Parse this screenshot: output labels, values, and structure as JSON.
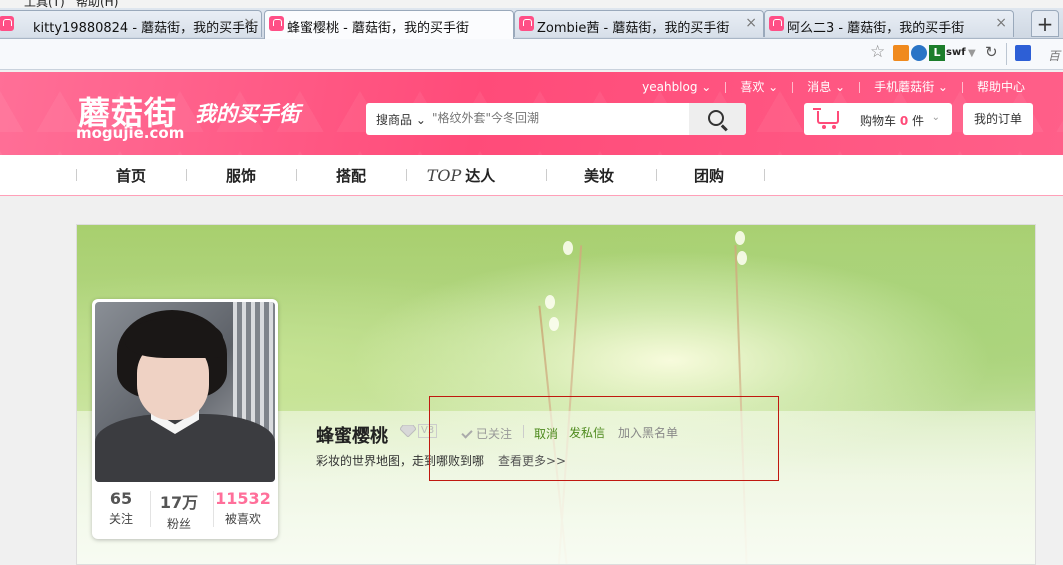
{
  "browser": {
    "menu_items": [
      "工具(T)",
      "帮助(H)"
    ],
    "tabs": [
      {
        "title": "kitty19880824 - 蘑菇街，我的买手街",
        "active": false
      },
      {
        "title": "蜂蜜樱桃 - 蘑菇街，我的买手街",
        "active": true
      },
      {
        "title": "Zombie茜 - 蘑菇街，我的买手街",
        "active": false
      },
      {
        "title": "阿么二3 - 蘑菇街，我的买手街",
        "active": false
      }
    ],
    "new_tab_label": "+",
    "close_glyph": "×",
    "toolbar": {
      "star_icon": "☆",
      "ext_label": "L",
      "swf_label": "swf",
      "dropdown_glyph": "▼",
      "refresh_glyph": "↻",
      "search_hint": "百"
    }
  },
  "header": {
    "logo_text": "蘑菇街",
    "logo_domain": "mogujie.com",
    "slogan": "我的买手街",
    "topnav": [
      "yeahblog ⌄",
      "喜欢 ⌄",
      "消息 ⌄",
      "手机蘑菇街 ⌄",
      "帮助中心"
    ],
    "search": {
      "type_label": "搜商品 ⌄",
      "placeholder": "\"格纹外套\"今冬回潮"
    },
    "cart": {
      "label_prefix": "购物车",
      "count": "0",
      "label_suffix": "件",
      "caret": "⌄"
    },
    "my_orders": "我的订单",
    "accent_color": "#ff4b79"
  },
  "nav": {
    "items": [
      "首页",
      "服饰",
      "搭配",
      "达人",
      "美妆",
      "团购"
    ],
    "top_logo": "TOP"
  },
  "profile": {
    "username": "蜂蜜樱桃",
    "level": "V3",
    "follow_status": "已关注",
    "cancel": "取消",
    "private_message": "发私信",
    "blacklist": "加入黑名单",
    "bio": "彩妆的世界地图，走到哪败到哪",
    "more": "查看更多>>",
    "stats": [
      {
        "value": "65",
        "label": "关注"
      },
      {
        "value": "17万",
        "label": "粉丝"
      },
      {
        "value": "11532",
        "label": "被喜欢"
      }
    ],
    "link_color": "#4d8a1d",
    "highlight_color": "#ff6f9a"
  }
}
